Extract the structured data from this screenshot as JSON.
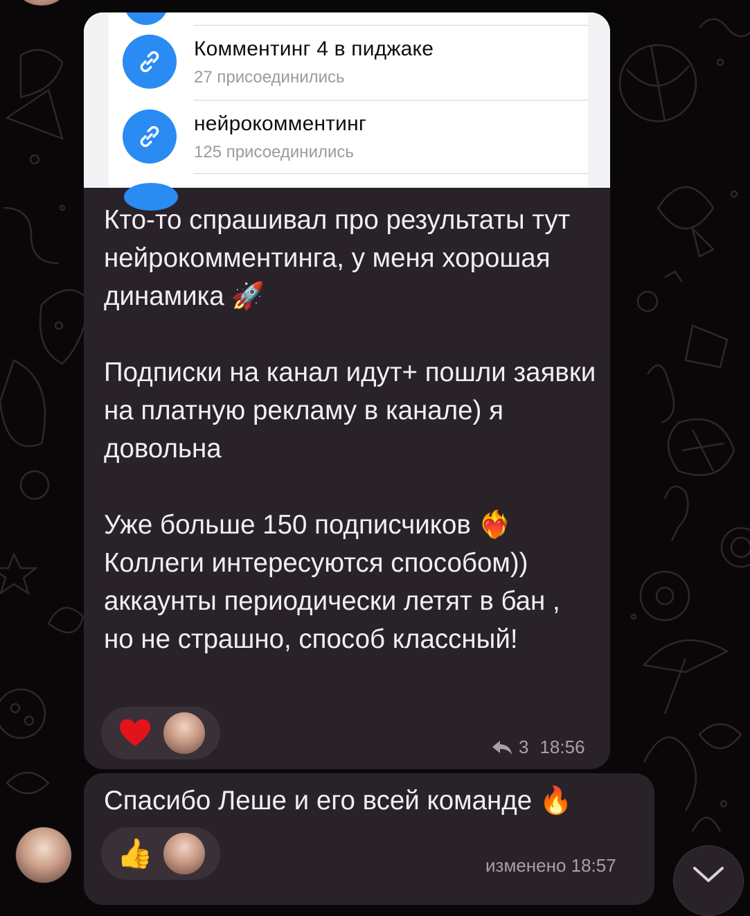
{
  "screenshot": {
    "items": [
      {
        "title": "Комментинг 4 в пиджаке",
        "subtitle": "27 присоединились"
      },
      {
        "title": "нейрокомментинг",
        "subtitle": "125 присоединились"
      }
    ]
  },
  "message1": {
    "text": "Кто-то спрашивал про результаты тут нейрокомментинга, у меня хорошая динамика 🚀\n\nПодписки на канал идут+ пошли заявки на платную рекламу в канале) я довольна\n\nУже больше 150 подписчиков ❤️‍🔥 Коллеги интересуются способом)) аккаунты периодически летят в бан , но не страшно, способ классный!",
    "reaction_emoji": "❤️",
    "reply_count": "3",
    "time": "18:56"
  },
  "message2": {
    "text": "Спасибо Леше и его всей команде 🔥",
    "reaction_emoji": "👍",
    "time": "изменено 18:57"
  },
  "icons": {
    "link": "link-icon",
    "reply": "reply-arrow-icon",
    "scroll_down": "chevron-down-icon"
  },
  "colors": {
    "background": "#0a0709",
    "bubble": "#2a2229",
    "reaction_pill": "#3a3038",
    "link_icon_bg": "#2a8bf2",
    "text": "#f2eef1",
    "meta": "#a7a0a6"
  }
}
